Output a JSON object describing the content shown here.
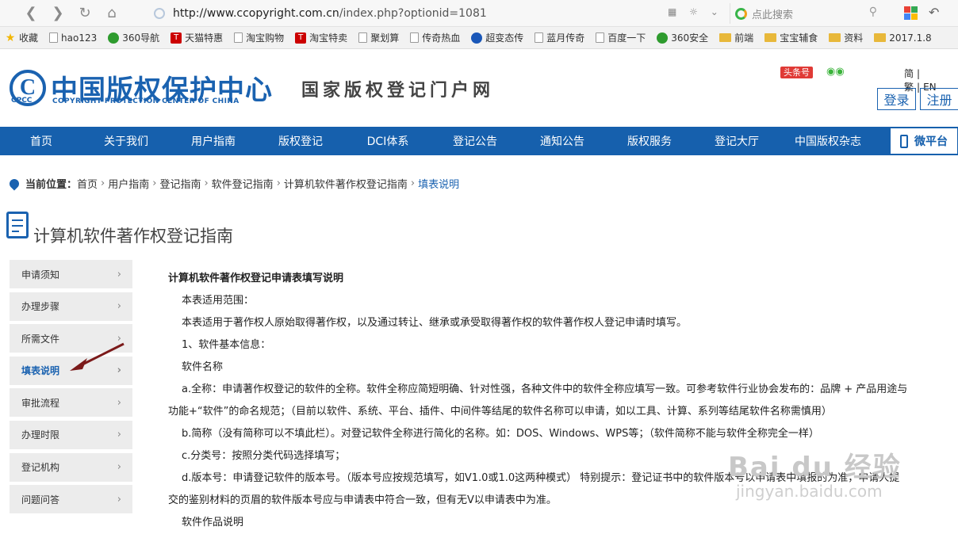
{
  "browser": {
    "url_host": "http://www.ccopyright.com.cn",
    "url_path": "/index.php?optionid=1081",
    "search_placeholder": "点此搜索",
    "bookmarks": [
      {
        "label": "收藏",
        "icon": "star-icon"
      },
      {
        "label": "hao123",
        "icon": "page-icon"
      },
      {
        "label": "360导航",
        "icon": "g360-icon"
      },
      {
        "label": "天猫特惠",
        "icon": "tmall-icon"
      },
      {
        "label": "淘宝购物",
        "icon": "page-icon"
      },
      {
        "label": "淘宝特卖",
        "icon": "tmall-icon"
      },
      {
        "label": "聚划算",
        "icon": "page-icon"
      },
      {
        "label": "传奇热血",
        "icon": "page-icon"
      },
      {
        "label": "超变态传",
        "icon": "chao-icon"
      },
      {
        "label": "蓝月传奇",
        "icon": "page-icon"
      },
      {
        "label": "百度一下",
        "icon": "page-icon"
      },
      {
        "label": "360安全",
        "icon": "g360-icon"
      },
      {
        "label": "前端",
        "icon": "folder-icon"
      },
      {
        "label": "宝宝辅食",
        "icon": "folder-icon"
      },
      {
        "label": "资料",
        "icon": "folder-icon"
      },
      {
        "label": "2017.1.8",
        "icon": "folder-icon"
      }
    ]
  },
  "header": {
    "logo_cn": "中国版权保护中心",
    "logo_en": "COPYRIGHT PROTECTION CENTER OF CHINA",
    "logo_abbr": "CPCC",
    "slogan": "国家版权登记门户网",
    "toutiao": "头条号",
    "lang": [
      "简",
      "繁",
      "EN"
    ],
    "login": "登录",
    "register": "注册"
  },
  "nav": {
    "items": [
      "首页",
      "关于我们",
      "用户指南",
      "版权登记",
      "DCI体系",
      "登记公告",
      "通知公告",
      "版权服务",
      "登记大厅",
      "中国版权杂志"
    ],
    "weipt": "微平台"
  },
  "breadcrumb": {
    "label": "当前位置：",
    "items": [
      "首页",
      "用户指南",
      "登记指南",
      "软件登记指南",
      "计算机软件著作权登记指南"
    ],
    "current": "填表说明"
  },
  "page_title": "计算机软件著作权登记指南",
  "sidebar": [
    {
      "label": "申请须知",
      "active": false
    },
    {
      "label": "办理步骤",
      "active": false
    },
    {
      "label": "所需文件",
      "active": false
    },
    {
      "label": "填表说明",
      "active": true
    },
    {
      "label": "审批流程",
      "active": false
    },
    {
      "label": "办理时限",
      "active": false
    },
    {
      "label": "登记机构",
      "active": false
    },
    {
      "label": "问题问答",
      "active": false
    }
  ],
  "content": {
    "title": "计算机软件著作权登记申请表填写说明",
    "lines": [
      {
        "text": "本表适用范围：",
        "indent": true
      },
      {
        "text": "本表适用于著作权人原始取得著作权，以及通过转让、继承或承受取得著作权的软件著作权人登记申请时填写。",
        "indent": true
      },
      {
        "text": "1、软件基本信息：",
        "indent": true
      },
      {
        "text": "软件名称",
        "indent": true
      },
      {
        "text": "a.全称：申请著作权登记的软件的全称。软件全称应简短明确、针对性强，各种文件中的软件全称应填写一致。可参考软件行业协会发布的：品牌 + 产品用途与",
        "indent": true
      },
      {
        "text": "功能+“软件”的命名规范；（目前以软件、系统、平台、插件、中间件等结尾的软件名称可以申请，如以工具、计算、系列等结尾软件名称需慎用）",
        "indent": false
      },
      {
        "text": "b.简称（没有简称可以不填此栏）。对登记软件全称进行简化的名称。如：DOS、Windows、WPS等；（软件简称不能与软件全称完全一样）",
        "indent": true
      },
      {
        "text": "c.分类号：按照分类代码选择填写；",
        "indent": true
      },
      {
        "text": "d.版本号：申请登记软件的版本号。（版本号应按规范填写，如V1.0或1.0这两种模式） 特别提示：登记证书中的软件版本号以申请表中填报的为准，申请人提",
        "indent": true
      },
      {
        "text": "交的鉴别材料的页眉的软件版本号应与申请表中符合一致，但有无V以申请表中为准。",
        "indent": false
      },
      {
        "text": "软件作品说明",
        "indent": true
      }
    ]
  },
  "watermark": {
    "main": "Bai du 经验",
    "sub": "jingyan.baidu.com"
  },
  "colors": {
    "brand": "#1660ad",
    "active_link": "#1a62b0"
  }
}
